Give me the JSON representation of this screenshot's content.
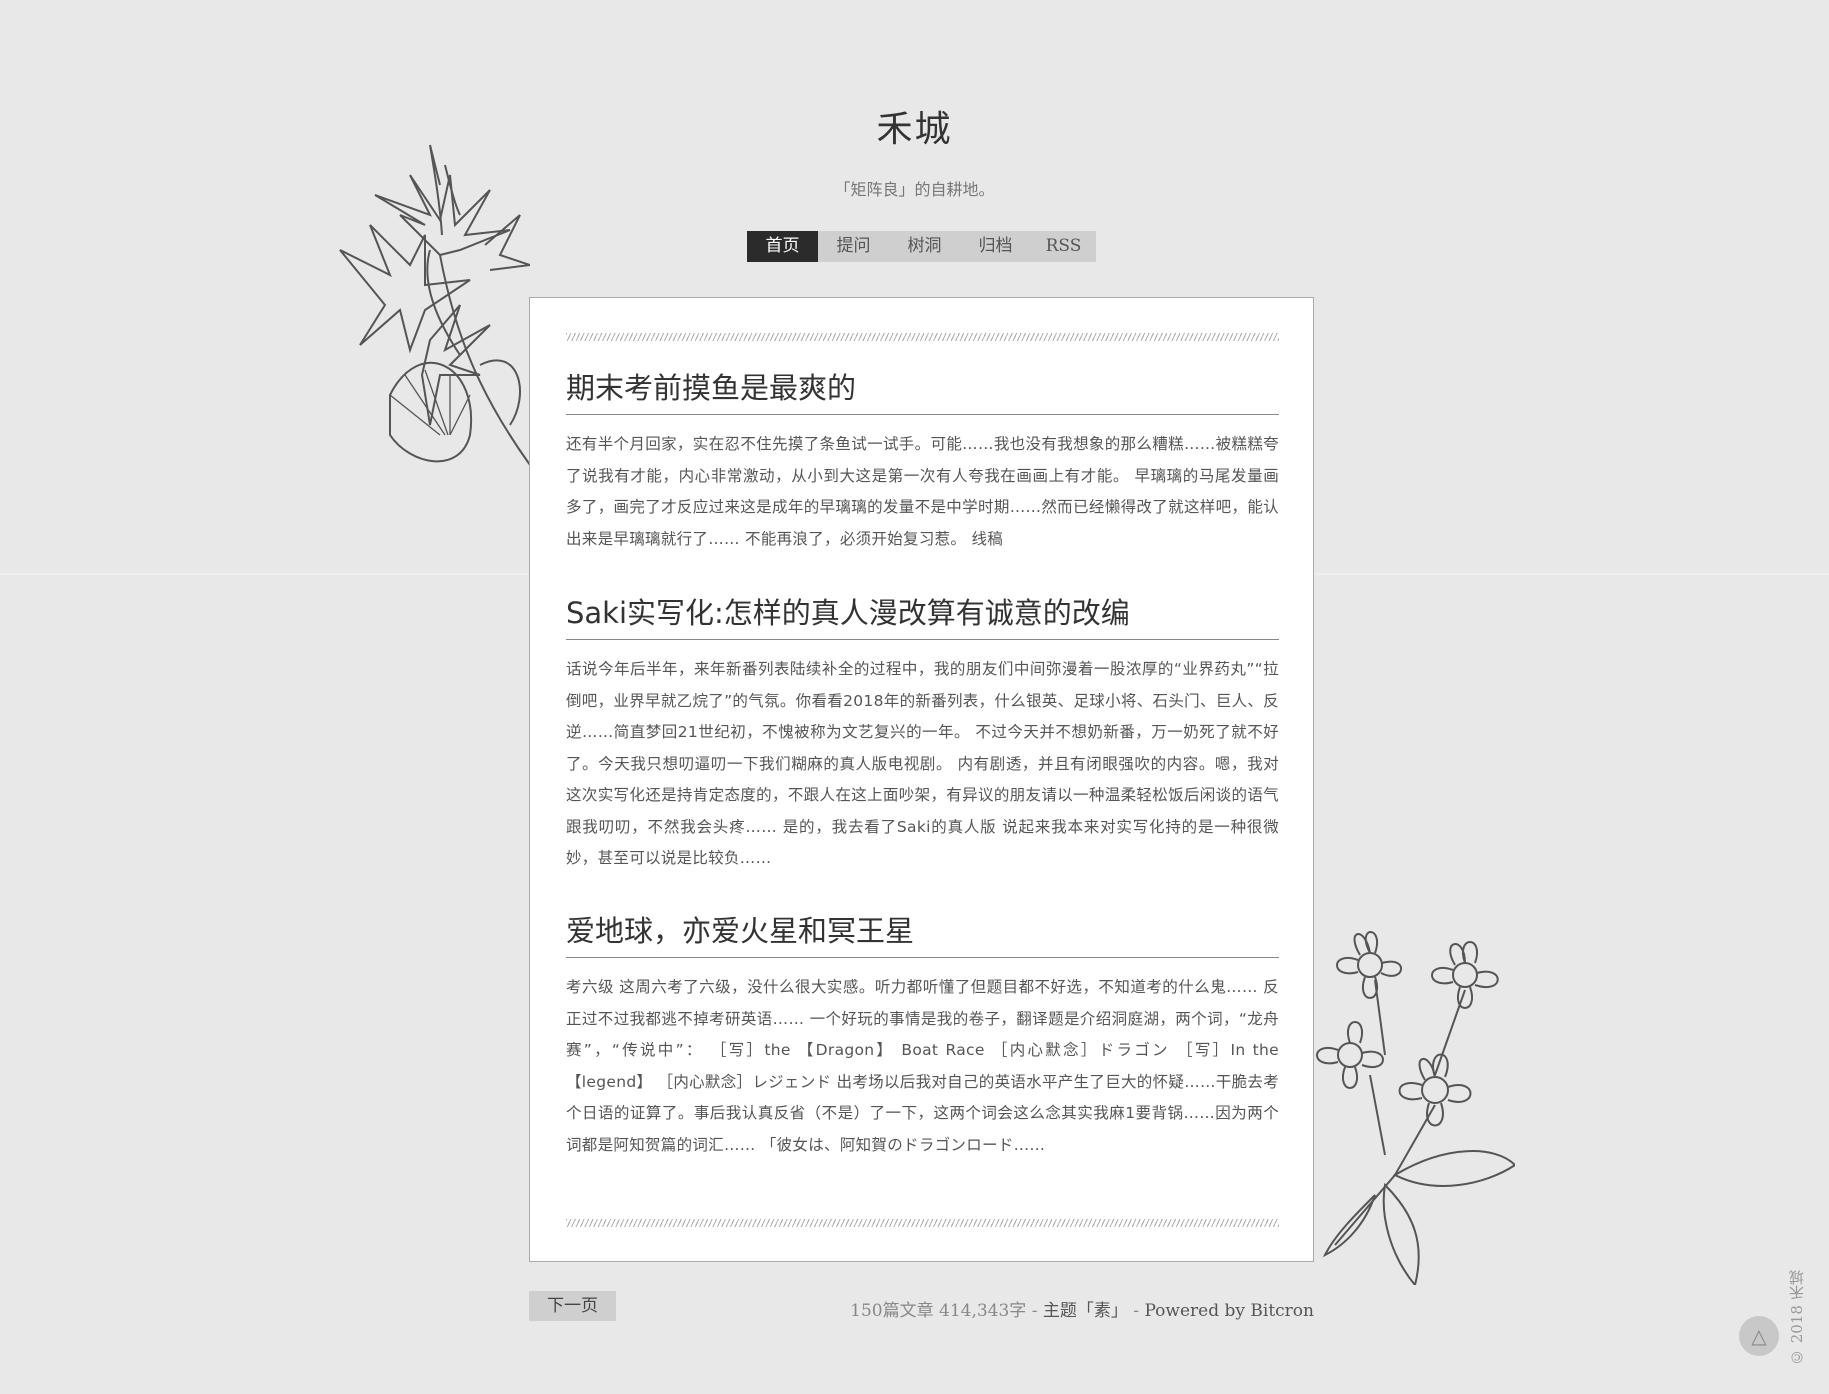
{
  "site": {
    "title": "禾城",
    "description": "「矩阵良」的自耕地。"
  },
  "nav": {
    "items": [
      {
        "label": "首页",
        "active": true
      },
      {
        "label": "提问",
        "active": false
      },
      {
        "label": "树洞",
        "active": false
      },
      {
        "label": "归档",
        "active": false
      },
      {
        "label": "RSS",
        "active": false
      }
    ]
  },
  "posts": [
    {
      "title": "期末考前摸鱼是最爽的",
      "excerpt": "还有半个月回家，实在忍不住先摸了条鱼试一试手。可能……我也没有我想象的那么糟糕……被糕糕夸了说我有才能，内心非常激动，从小到大这是第一次有人夸我在画画上有才能。 早璃璃的马尾发量画多了，画完了才反应过来这是成年的早璃璃的发量不是中学时期……然而已经懒得改了就这样吧，能认出来是早璃璃就行了…… 不能再浪了，必须开始复习惹。 线稿"
    },
    {
      "title": "Saki实写化:怎样的真人漫改算有诚意的改编",
      "excerpt": "话说今年后半年，来年新番列表陆续补全的过程中，我的朋友们中间弥漫着一股浓厚的“业界药丸”“拉倒吧，业界早就乙烷了”的气氛。你看看2018年的新番列表，什么银英、足球小将、石头门、巨人、反逆……简直梦回21世纪初，不愧被称为文艺复兴的一年。 不过今天并不想奶新番，万一奶死了就不好了。今天我只想叨逼叨一下我们糊麻的真人版电视剧。 内有剧透，并且有闭眼强吹的内容。嗯，我对这次实写化还是持肯定态度的，不跟人在这上面吵架，有异议的朋友请以一种温柔轻松饭后闲谈的语气跟我叨叨，不然我会头疼…… 是的，我去看了Saki的真人版 说起来我本来对实写化持的是一种很微妙，甚至可以说是比较负……"
    },
    {
      "title": "爱地球，亦爱火星和冥王星",
      "excerpt": "考六级 这周六考了六级，没什么很大实感。听力都听懂了但题目都不好选，不知道考的什么鬼…… 反正过不过我都逃不掉考研英语…… 一个好玩的事情是我的卷子，翻译题是介绍洞庭湖，两个词，“龙舟赛”，“传说中”： ［写］the 【Dragon】 Boat Race ［内心默念］ドラゴン ［写］In the 【legend】 ［内心默念］レジェンド 出考场以后我对自己的英语水平产生了巨大的怀疑……干脆去考个日语的证算了。事后我认真反省（不是）了一下，这两个词会这么念其实我麻1要背锅……因为两个词都是阿知贺篇的词汇…… 「彼女は、阿知賀のドラゴンロード……"
    }
  ],
  "pagination": {
    "next_label": "下一页"
  },
  "footer": {
    "stats": "150篇文章 414,343字",
    "sep1": " - ",
    "theme_label": "主题「素」",
    "sep2": " - ",
    "powered": "Powered by Bitcron",
    "copyright": "© 2018 禾城"
  },
  "icons": {
    "back_to_top": "triangle-up-icon",
    "decor_top": "lily-flower-illustration",
    "decor_bottom": "blossom-flower-illustration"
  }
}
